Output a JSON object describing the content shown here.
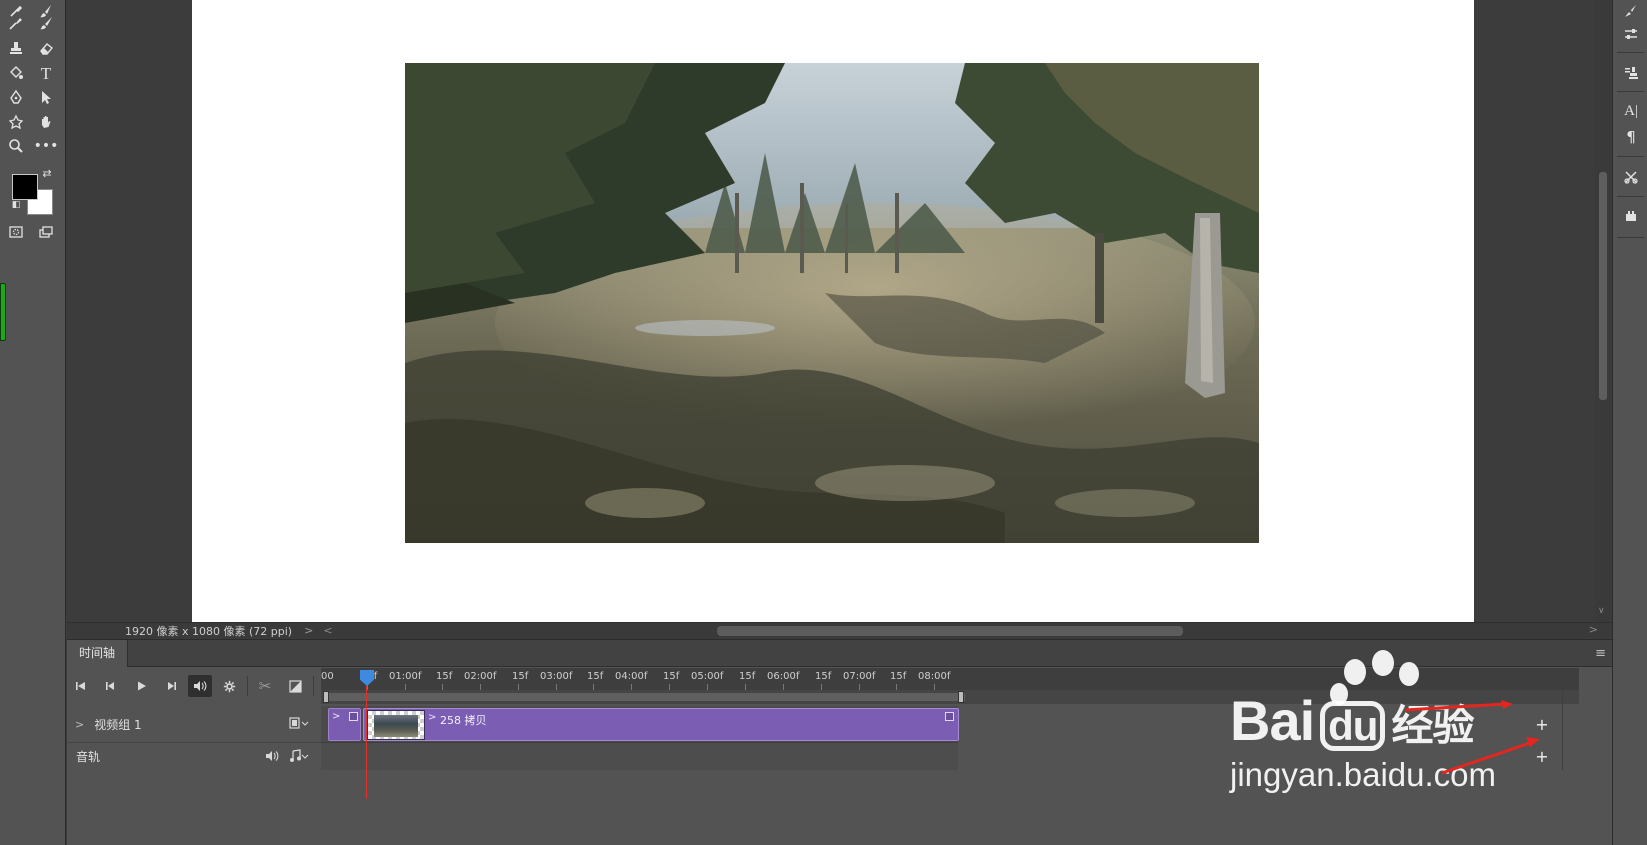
{
  "document": {
    "info": "1920 像素 x 1080 像素 (72 ppi)"
  },
  "timeline": {
    "tab_label": "时间轴",
    "ruler_labels": [
      "00",
      "15f",
      "01:00f",
      "15f",
      "02:00f",
      "15f",
      "03:00f",
      "15f",
      "04:00f",
      "15f",
      "05:00f",
      "15f",
      "06:00f",
      "15f",
      "07:00f",
      "15f",
      "08:00f"
    ],
    "video_track_name": "视频组 1",
    "audio_track_name": "音轨",
    "clip_name": "258 拷贝"
  },
  "watermark": {
    "brand": "Bai",
    "brand_suffix": "经验",
    "url": "jingyan.baidu.com"
  },
  "colors": {
    "clip_purple": "#7c5db4",
    "playhead_blue": "#3d8ae0",
    "playhead_red": "#e0322a",
    "foreground_swatch": "#000000",
    "background_swatch": "#ffffff",
    "annotation_arrow": "#e5261f"
  },
  "icons": {
    "toolbar": [
      "eyedropper-icon",
      "brush-icon",
      "stamp-icon",
      "eraser-icon",
      "fill-icon",
      "type-icon",
      "pen-icon",
      "selection-arrow-icon",
      "shape-icon",
      "hand-icon",
      "zoom-icon",
      "more-icon"
    ],
    "right_strip": [
      "brush-settings-icon",
      "adjustments-icon",
      "clone-source-icon",
      "character-icon",
      "paragraph-icon",
      "tools-icon",
      "plugin-icon"
    ],
    "timeline_controls": [
      "go-to-first-frame-icon",
      "previous-frame-icon",
      "play-icon",
      "next-frame-icon",
      "audio-icon",
      "settings-gear-icon",
      "split-scissors-icon",
      "transition-icon"
    ]
  }
}
